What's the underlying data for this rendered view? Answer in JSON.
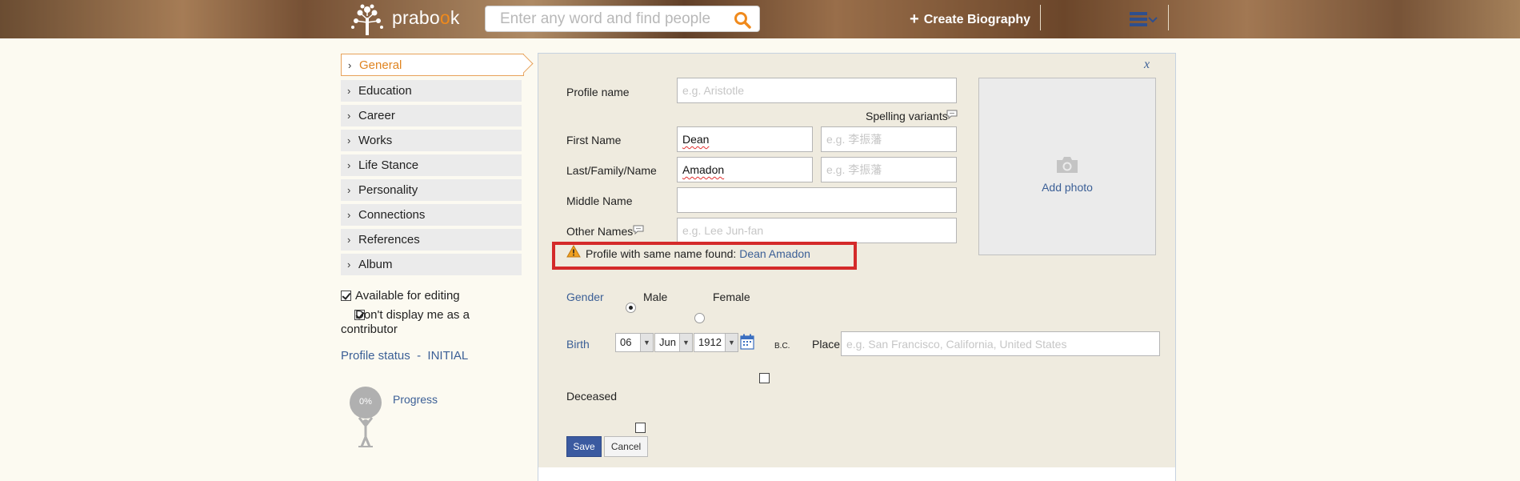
{
  "header": {
    "logo_text_pre": "prabo",
    "logo_text_o": "o",
    "logo_text_post": "k",
    "search_placeholder": "Enter any word and find people",
    "create_biography": "Create Biography"
  },
  "sidebar": {
    "items": [
      {
        "label": "General",
        "active": true
      },
      {
        "label": "Education"
      },
      {
        "label": "Career"
      },
      {
        "label": "Works"
      },
      {
        "label": "Life Stance"
      },
      {
        "label": "Personality"
      },
      {
        "label": "Connections"
      },
      {
        "label": "References"
      },
      {
        "label": "Album"
      }
    ],
    "available_for_editing": "Available for editing",
    "dont_display_line1": "Don't display me as a",
    "dont_display_line2": "contributor",
    "profile_status_label": "Profile status",
    "profile_status_sep": "-",
    "profile_status_value": "INITIAL",
    "progress_percent": "0%",
    "progress_label": "Progress"
  },
  "form": {
    "close": "x",
    "profile_name_label": "Profile name",
    "profile_name_placeholder": "e.g. Aristotle",
    "spelling_variants": "Spelling variants",
    "first_name_label": "First Name",
    "first_name_value": "Dean",
    "first_name_alt_placeholder": "e.g. 李振藩",
    "last_name_label": "Last/Family/Name",
    "last_name_value": "Amadon",
    "last_name_alt_placeholder": "e.g. 李振藩",
    "middle_name_label": "Middle Name",
    "other_names_label": "Other Names",
    "other_names_placeholder": "e.g. Lee Jun-fan",
    "warning_text": "Profile with same name found:",
    "warning_link": "Dean Amadon",
    "add_photo": "Add photo",
    "gender_label": "Gender",
    "gender_male": "Male",
    "gender_female": "Female",
    "birth_label": "Birth",
    "birth_day": "06",
    "birth_month": "Jun",
    "birth_year": "1912",
    "bc_label": "B.C.",
    "place_label": "Place",
    "place_placeholder": "e.g. San Francisco, California, United States",
    "deceased_label": "Deceased",
    "save": "Save",
    "cancel": "Cancel"
  }
}
